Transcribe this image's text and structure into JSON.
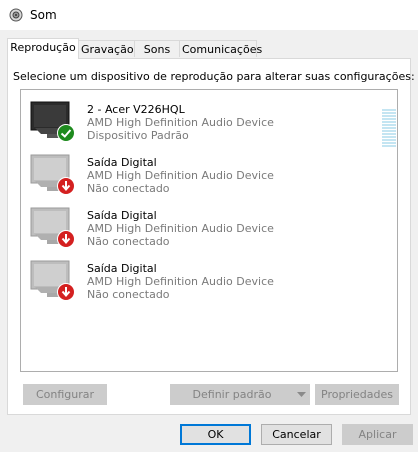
{
  "window": {
    "title": "Som"
  },
  "tabs": [
    {
      "label": "Reprodução",
      "active": true
    },
    {
      "label": "Gravação",
      "active": false
    },
    {
      "label": "Sons",
      "active": false
    },
    {
      "label": "Comunicações",
      "active": false
    }
  ],
  "instruction": "Selecione um dispositivo de reprodução para alterar suas configurações:",
  "devices": [
    {
      "name": "2 - Acer V226HQL",
      "description": "AMD High Definition Audio Device",
      "status": "Dispositivo Padrão",
      "badge": "check-icon",
      "badge_color": "#1e8a1e"
    },
    {
      "name": "Saída Digital",
      "description": "AMD High Definition Audio Device",
      "status": "Não conectado",
      "badge": "down-arrow-icon",
      "badge_color": "#d42020"
    },
    {
      "name": "Saída Digital",
      "description": "AMD High Definition Audio Device",
      "status": "Não conectado",
      "badge": "down-arrow-icon",
      "badge_color": "#d42020"
    },
    {
      "name": "Saída Digital",
      "description": "AMD High Definition Audio Device",
      "status": "Não conectado",
      "badge": "down-arrow-icon",
      "badge_color": "#d42020"
    }
  ],
  "buttons": {
    "configure": "Configurar",
    "set_default": "Definir padrão",
    "properties": "Propriedades",
    "ok": "OK",
    "cancel": "Cancelar",
    "apply": "Aplicar"
  },
  "colors": {
    "accent": "#0078d7",
    "meter": "#c4e5f2"
  }
}
